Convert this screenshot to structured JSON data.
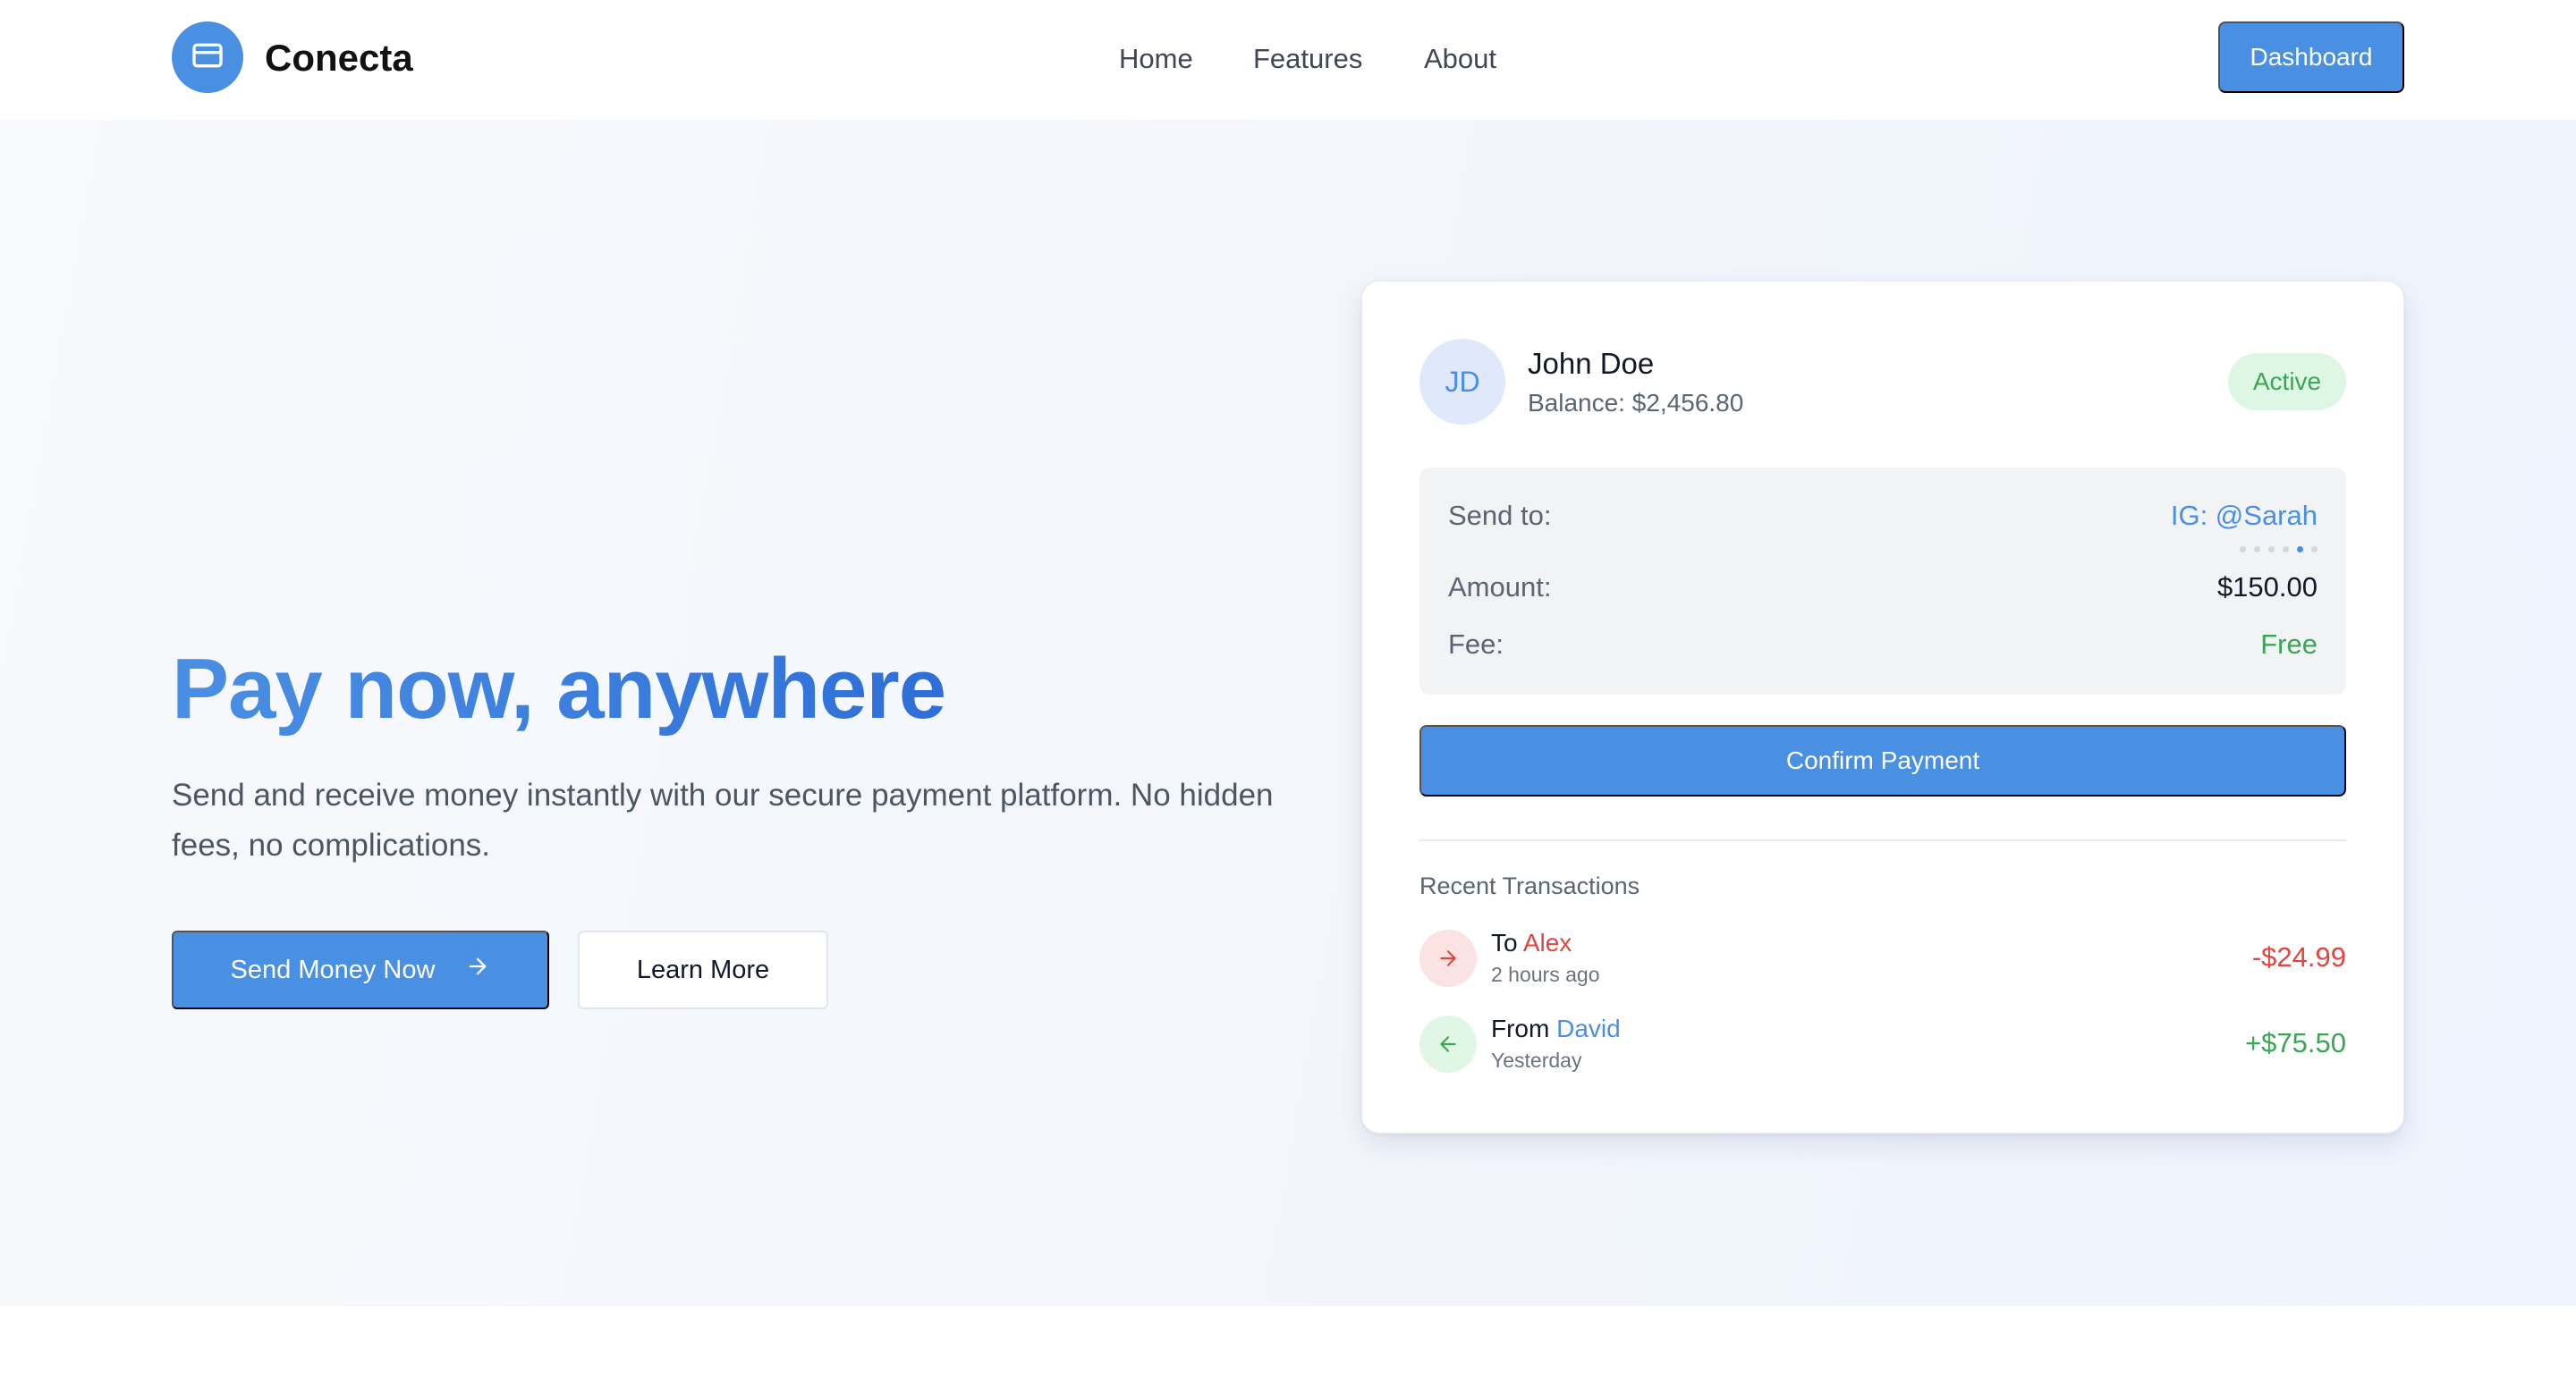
{
  "header": {
    "brand": "Conecta",
    "logo_icon": "credit-card-icon",
    "nav": [
      {
        "label": "Home"
      },
      {
        "label": "Features"
      },
      {
        "label": "About"
      }
    ],
    "dashboard_label": "Dashboard"
  },
  "hero": {
    "headline": "Pay now, anywhere",
    "subtext": "Send and receive money instantly with our secure payment platform. No hidden fees, no complications.",
    "primary_cta": "Send Money Now",
    "primary_cta_icon": "arrow-right-icon",
    "secondary_cta": "Learn More"
  },
  "card": {
    "avatar_initials": "JD",
    "user_name": "John Doe",
    "balance": "Balance: $2,456.80",
    "status": "Active",
    "details": {
      "send_to_label": "Send to:",
      "send_to_value": "IG: @Sarah",
      "carousel_active_index": 5,
      "carousel_count": 6,
      "amount_label": "Amount:",
      "amount_value": "$150.00",
      "fee_label": "Fee:",
      "fee_value": "Free"
    },
    "confirm_label": "Confirm Payment",
    "recent_title": "Recent Transactions",
    "transactions": [
      {
        "direction_prefix": "To",
        "name": "Alex",
        "time": "2 hours ago",
        "amount": "-$24.99",
        "icon": "arrow-right-icon"
      },
      {
        "direction_prefix": "From",
        "name": "David",
        "time": "Yesterday",
        "amount": "+$75.50",
        "icon": "arrow-left-icon"
      }
    ]
  },
  "colors": {
    "accent": "#4a90e2",
    "success": "#3aa655",
    "danger": "#e0463f"
  }
}
